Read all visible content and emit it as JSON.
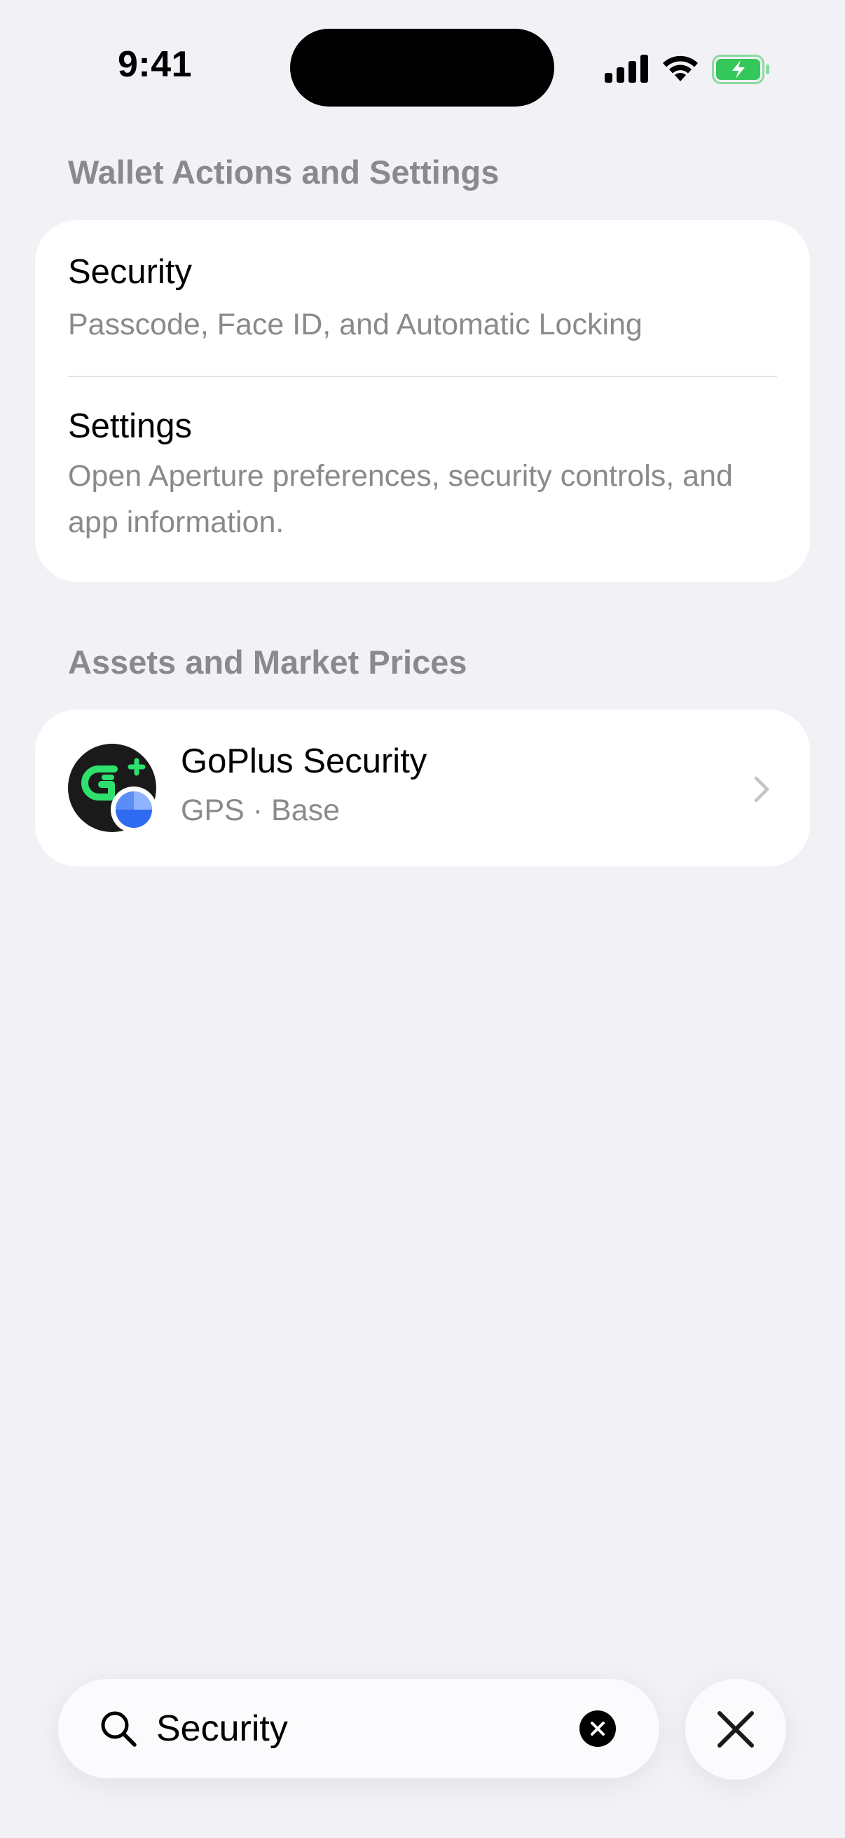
{
  "status_bar": {
    "time": "9:41"
  },
  "sections": {
    "wallet_actions": {
      "header": "Wallet Actions and Settings",
      "items": [
        {
          "title": "Security",
          "subtitle": "Passcode, Face ID, and Automatic Locking"
        },
        {
          "title": "Settings",
          "subtitle": "Open Aperture preferences, security controls, and app information."
        }
      ]
    },
    "assets": {
      "header": "Assets and Market Prices",
      "items": [
        {
          "name": "GoPlus Security",
          "meta": "GPS · Base",
          "icon": "goplus-logo-icon",
          "badge_icon": "base-network-icon"
        }
      ]
    }
  },
  "search": {
    "value": "Security"
  },
  "colors": {
    "background": "#F1F1F6",
    "card": "#FFFFFF",
    "secondary_text": "#8A8A8E",
    "accent_green": "#2EE06E",
    "battery_green": "#34C759",
    "base_blue": "#2F6BF0",
    "caret": "#2F6BF0"
  }
}
